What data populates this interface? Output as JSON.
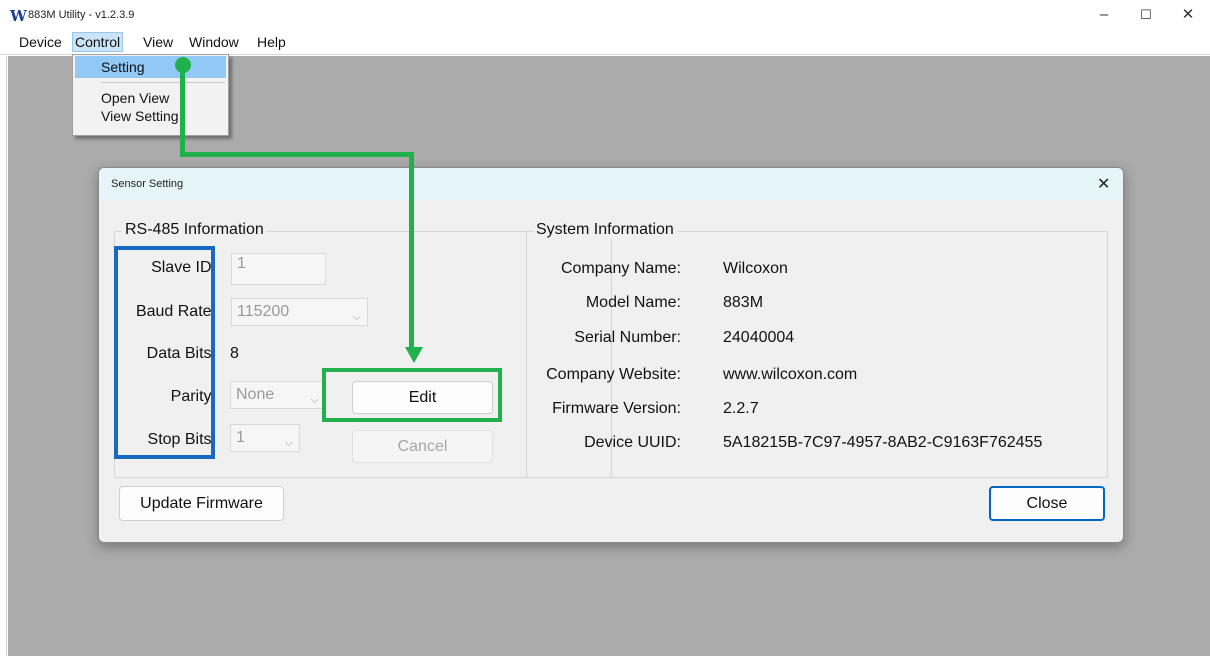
{
  "window": {
    "logo_letter": "W",
    "title": "883M Utility - v1.2.3.9",
    "minimize": "–",
    "maximize": "☐",
    "close": "✕"
  },
  "menubar": {
    "items": [
      "Device",
      "Control",
      "View",
      "Window",
      "Help"
    ]
  },
  "control_menu": {
    "items": [
      "Setting",
      "Open View",
      "View Setting"
    ],
    "highlighted": "Setting"
  },
  "dialog": {
    "title": "Sensor Setting",
    "close": "✕",
    "rs485": {
      "legend": "RS-485 Information",
      "slave_id_label": "Slave ID:",
      "slave_id_value": "1",
      "baud_rate_label": "Baud Rate:",
      "baud_rate_value": "115200",
      "data_bits_label": "Data Bits:",
      "data_bits_value": "8",
      "parity_label": "Parity:",
      "parity_value": "None",
      "stop_bits_label": "Stop Bits:",
      "stop_bits_value": "1",
      "edit_button": "Edit",
      "cancel_button": "Cancel"
    },
    "system": {
      "legend": "System Information",
      "rows": [
        {
          "label": "Company Name:",
          "value": "Wilcoxon"
        },
        {
          "label": "Model Name:",
          "value": "883M"
        },
        {
          "label": "Serial Number:",
          "value": "24040004"
        },
        {
          "label": "Company Website:",
          "value": "www.wilcoxon.com"
        },
        {
          "label": "Firmware Version:",
          "value": "2.2.7"
        },
        {
          "label": "Device UUID:",
          "value": "5A18215B-7C97-4957-8AB2-C9163F762455"
        }
      ]
    },
    "update_firmware_button": "Update Firmware",
    "close_button": "Close"
  },
  "annotation_colors": {
    "blue_highlight": "#1769c1",
    "green_highlight": "#21b14c"
  }
}
